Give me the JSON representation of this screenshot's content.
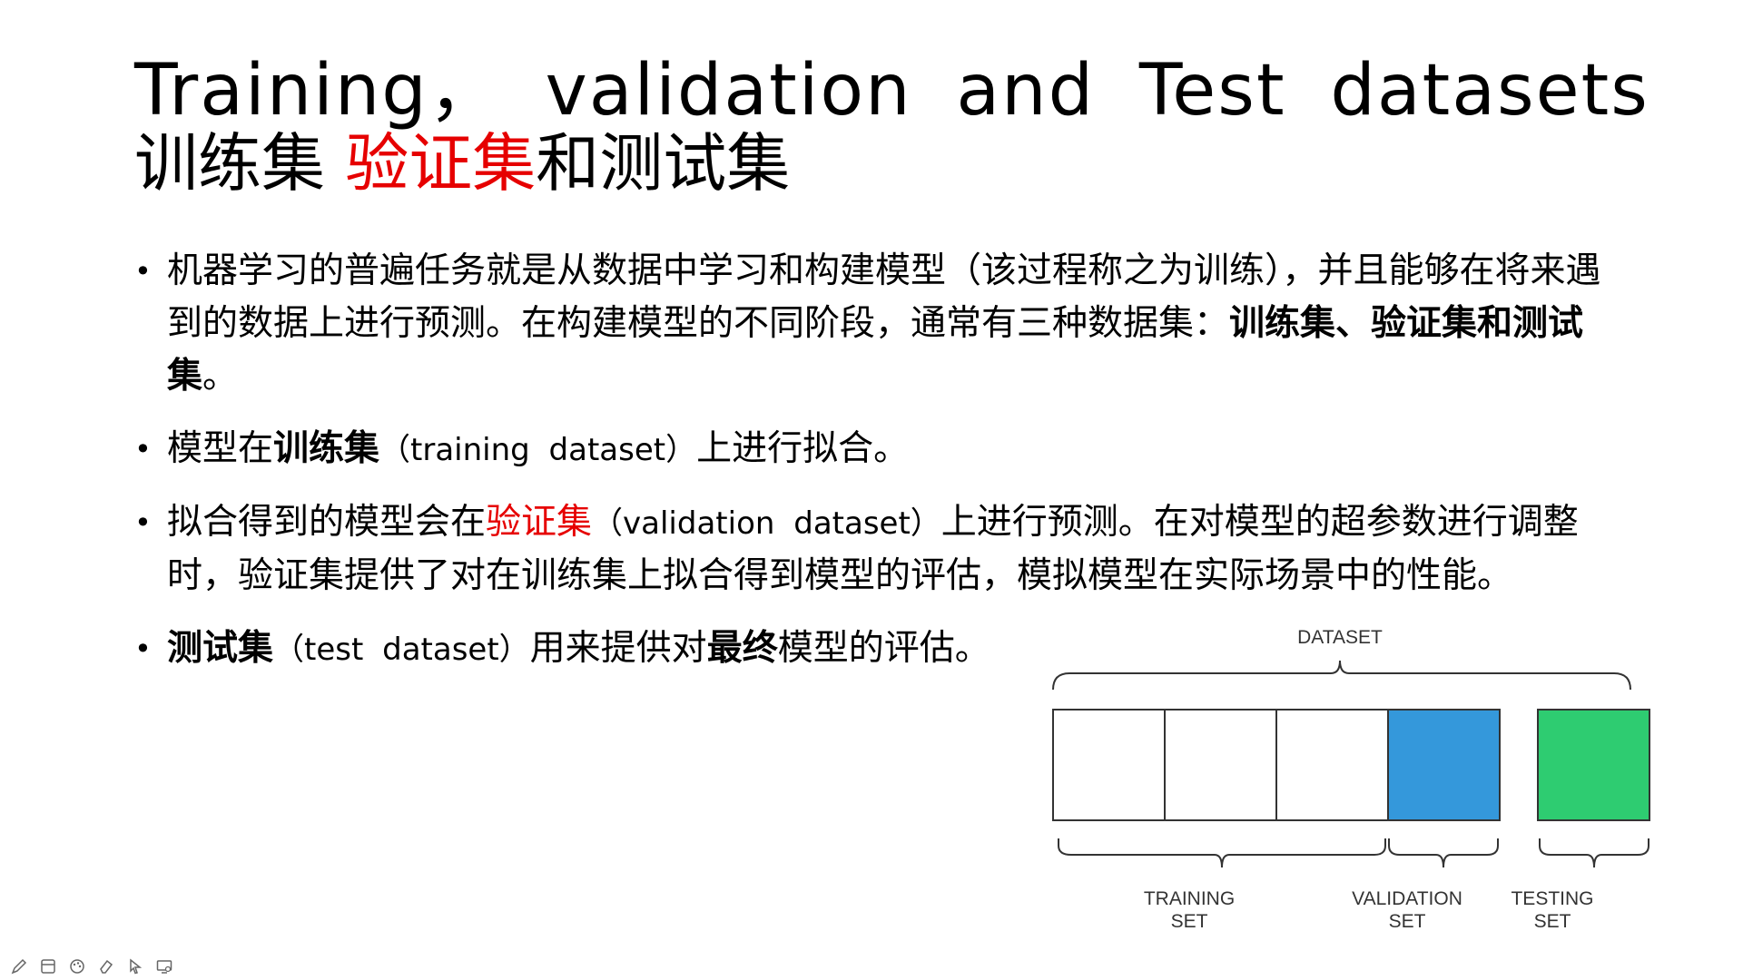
{
  "title": {
    "english": "Training， validation and Test datasets",
    "chinese_part1": "训练集 ",
    "chinese_highlight": "验证集",
    "chinese_part2": "和测试集"
  },
  "bullets": {
    "b1": {
      "text": "机器学习的普遍任务就是从数据中学习和构建模型（该过程称之为训练），并且能够在将来遇到的数据上进行预测。在构建模型的不同阶段，通常有三种数据集：",
      "bold": "训练集、验证集和测试集",
      "end": "。"
    },
    "b2": {
      "pre": "模型在",
      "bold": "训练集",
      "en": "（training dataset）",
      "post": "上进行拟合。"
    },
    "b3": {
      "pre": "拟合得到的模型会在",
      "red": "验证集",
      "en": "（validation dataset）",
      "post": "上进行预测。在对模型的超参数进行调整时，验证集提供了对在训练集上拟合得到模型的评估，模拟模型在实际场景中的性能。"
    },
    "b4": {
      "bold1": "测试集",
      "en": "（test dataset）",
      "mid": "用来提供对",
      "bold2": "最终",
      "post": "模型的评估。"
    }
  },
  "diagram": {
    "top_label": "DATASET",
    "training_label": "TRAINING\nSET",
    "validation_label": "VALIDATION\nSET",
    "testing_label": "TESTING\nSET",
    "colors": {
      "validation_fill": "#3498db",
      "testing_fill": "#2ecc71",
      "training_fill": "#ffffff",
      "stroke": "#333333"
    }
  },
  "toolbar": {
    "icons": [
      "pen-icon",
      "slides-icon",
      "palette-icon",
      "eraser-icon",
      "pointer-icon",
      "screen-icon"
    ]
  }
}
